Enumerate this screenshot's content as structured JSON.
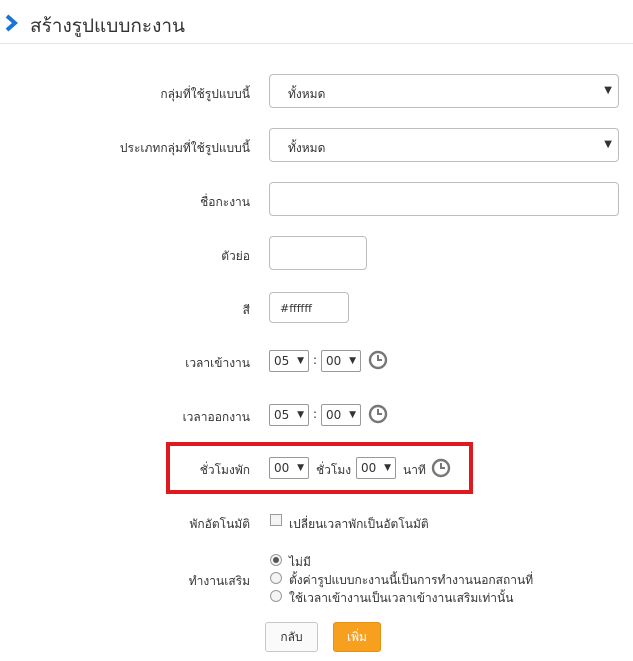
{
  "header": {
    "title": "สร้างรูปแบบกะงาน"
  },
  "form": {
    "group": {
      "label": "กลุ่มที่ใช้รูปแบบนี้",
      "value": "ทั้งหมด"
    },
    "group_type": {
      "label": "ประเภทกลุ่มที่ใช้รูปแบบนี้",
      "value": "ทั้งหมด"
    },
    "shift_name": {
      "label": "ชื่อกะงาน",
      "value": ""
    },
    "short_name": {
      "label": "ตัวย่อ",
      "value": ""
    },
    "color": {
      "label": "สี",
      "value": "#ffffff"
    },
    "start_time": {
      "label": "เวลาเข้างาน",
      "hour": "05",
      "minute": "00",
      "colon": ":"
    },
    "end_time": {
      "label": "เวลาออกงาน",
      "hour": "05",
      "minute": "00",
      "colon": ":"
    },
    "break_hours": {
      "label": "ชั่วโมงพัก",
      "hour": "00",
      "hour_unit": "ชั่วโมง",
      "minute": "00",
      "minute_unit": "นาที"
    },
    "auto_break": {
      "label": "พักอัตโนมัติ",
      "checkbox_label": "เปลี่ยนเวลาพักเป็นอัตโนมัติ",
      "checked": false
    },
    "overtime": {
      "label": "ทำงานเสริม",
      "options": [
        {
          "label": "ไม่มี",
          "selected": true
        },
        {
          "label": "ตั้งค่ารูปแบบกะงานนี้เป็นการทำงานนอกสถานที่",
          "selected": false
        },
        {
          "label": "ใช้เวลาเข้างานเป็นเวลาเข้างานเสริมเท่านั้น",
          "selected": false
        }
      ]
    }
  },
  "buttons": {
    "back": "กลับ",
    "add": "เพิ่ม"
  },
  "icons": {
    "header": "chevron-right-icon",
    "time": "clock-icon",
    "select": "caret-down-icon"
  },
  "colors": {
    "accent_blue": "#1a73d8",
    "highlight_red": "#e0181f",
    "add_button": "#f7a01f"
  }
}
